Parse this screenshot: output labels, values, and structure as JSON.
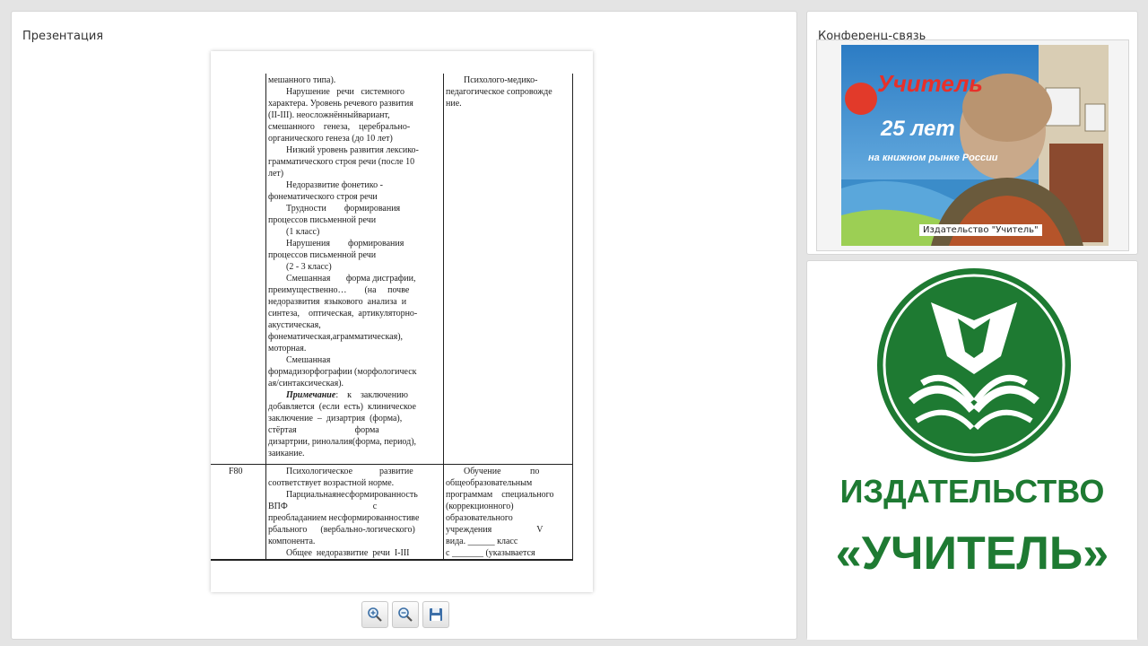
{
  "presentation": {
    "title": "Презентация",
    "document": {
      "rows_top": [
        "мешанного типа).",
        "Нарушение   речи   системного",
        "характера. Уровень речевого развития",
        "(II-III). неосложнённыйвариант,",
        "смешанного    генеза,    церебрально-",
        "органического генеза (до 10 лет)",
        "Низкий уровень развития лексико-",
        "грамматического строя речи (после 10",
        "лет)",
        "Недоразвитие фонетико -",
        "фонематического строя речи",
        "Трудности        формирования",
        "процессов письменной речи",
        "(1 класс)",
        "Нарушения        формирования",
        "процессов письменной речи",
        "(2 - 3 класс)",
        "Смешанная       форма дисграфии,",
        "преимущественно…        (на     почве",
        "недоразвития  языкового  анализа  и",
        "синтеза,    оптическая,  артикуляторно-",
        "акустическая,",
        "фонематическая,аграмматическая),",
        "моторная.",
        "Смешанная",
        "формадизорфографии (морфологическ",
        "ая/синтаксическая).",
        "Примечание:    к    заключению",
        "добавляется  (если  есть)  клиническое",
        "заключение  –  дизартрия  (форма),",
        "стёртая                          форма",
        "дизартрии, ринолалия(форма, период),",
        "заикание."
      ],
      "right_top": [
        "Психолого-медико-",
        "педагогическое сопровожде",
        "ние."
      ],
      "code_f80": "F80",
      "rows_bottom": [
        "Психологическое            развитие",
        "соответствует возрастной норме.",
        "Парциальнаянесформированность",
        "ВПФ                                      с",
        "преобладанием несформированностиве",
        "рбального      (вербально-логического)",
        "компонента.",
        "Общее  недоразвитие  речи  I-III"
      ],
      "right_bottom": [
        "Обучение             по",
        "общеобразовательным",
        "программам    специального",
        "(коррекционного)",
        "образовательного",
        "учреждения                    V",
        "вида. ______ класс",
        "с _______ (указывается"
      ]
    },
    "toolbar": {
      "zoom_in_icon": "magnifier-plus",
      "zoom_out_icon": "magnifier-minus",
      "save_icon": "floppy-disk"
    }
  },
  "conference": {
    "title": "Конференц-связь",
    "video_caption": "Издательство \"Учитель\"",
    "banner_text_1": "Учитель",
    "banner_text_2": "25 лет",
    "banner_text_3": "на книжном рынке России"
  },
  "logo": {
    "line1": "ИЗДАТЕЛЬСТВО",
    "line2": "«УЧИТЕЛЬ»",
    "brand_color": "#1e7a32"
  }
}
